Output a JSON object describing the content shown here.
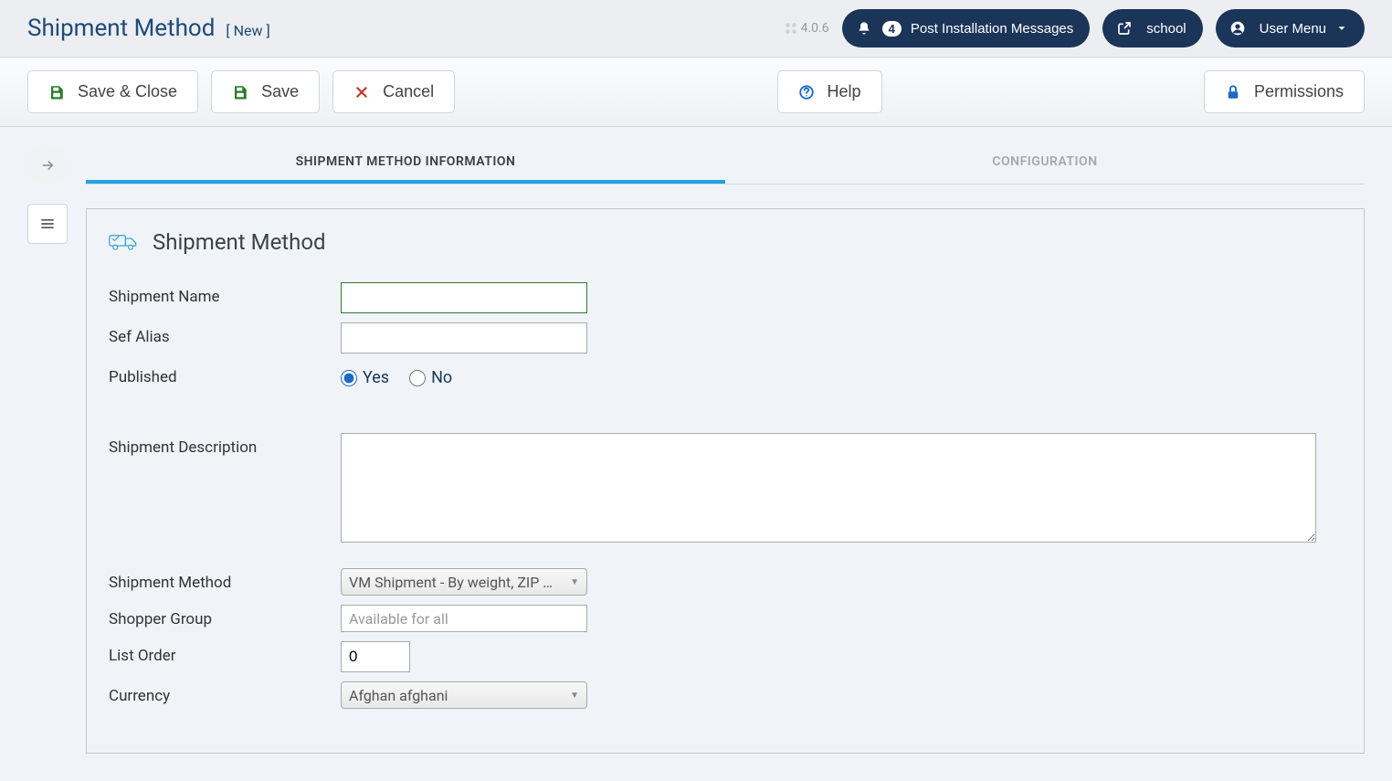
{
  "header": {
    "title": "Shipment Method",
    "subtitle": "[ New ]",
    "version": "4.0.6",
    "notifications": {
      "count": "4",
      "label": "Post Installation Messages"
    },
    "site": "school",
    "user_menu": "User Menu"
  },
  "toolbar": {
    "save_close": "Save & Close",
    "save": "Save",
    "cancel": "Cancel",
    "help": "Help",
    "permissions": "Permissions"
  },
  "tabs": {
    "info": "Shipment Method Information",
    "config": "Configuration"
  },
  "panel": {
    "title": "Shipment Method"
  },
  "form": {
    "shipment_name": {
      "label": "Shipment Name",
      "value": ""
    },
    "sef_alias": {
      "label": "Sef Alias",
      "value": ""
    },
    "published": {
      "label": "Published",
      "yes": "Yes",
      "no": "No",
      "selected": "yes"
    },
    "description": {
      "label": "Shipment Description",
      "value": ""
    },
    "method": {
      "label": "Shipment Method",
      "value": "VM Shipment - By weight, ZIP …"
    },
    "shopper_group": {
      "label": "Shopper Group",
      "placeholder": "Available for all"
    },
    "list_order": {
      "label": "List Order",
      "value": "0"
    },
    "currency": {
      "label": "Currency",
      "value": "Afghan afghani"
    }
  }
}
